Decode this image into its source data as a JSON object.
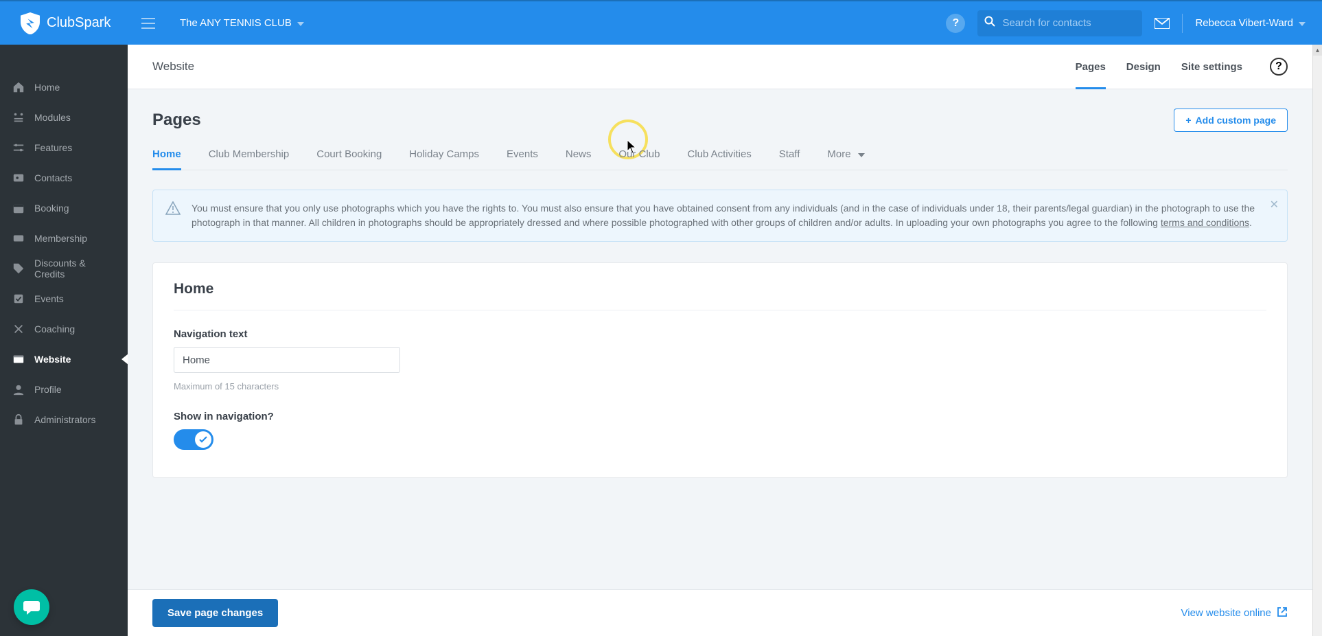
{
  "brand": {
    "name": "ClubSpark"
  },
  "club": {
    "name": "The ANY TENNIS CLUB"
  },
  "search": {
    "placeholder": "Search for contacts"
  },
  "help": {
    "symbol": "?"
  },
  "user": {
    "name": "Rebecca Vibert-Ward"
  },
  "sidebar": {
    "items": [
      {
        "label": "Home"
      },
      {
        "label": "Modules"
      },
      {
        "label": "Features"
      },
      {
        "label": "Contacts"
      },
      {
        "label": "Booking"
      },
      {
        "label": "Membership"
      },
      {
        "label": "Discounts & Credits"
      },
      {
        "label": "Events"
      },
      {
        "label": "Coaching"
      },
      {
        "label": "Website"
      },
      {
        "label": "Profile"
      },
      {
        "label": "Administrators"
      }
    ],
    "active_index": 9
  },
  "subheader": {
    "title": "Website",
    "tabs": [
      {
        "label": "Pages",
        "active": true
      },
      {
        "label": "Design",
        "active": false
      },
      {
        "label": "Site settings",
        "active": false
      }
    ],
    "help_q": "?"
  },
  "page": {
    "title": "Pages",
    "add_button": "Add custom page",
    "tabs": [
      {
        "label": "Home",
        "active": true
      },
      {
        "label": "Club Membership"
      },
      {
        "label": "Court Booking"
      },
      {
        "label": "Holiday Camps"
      },
      {
        "label": "Events"
      },
      {
        "label": "News"
      },
      {
        "label": "Our Club"
      },
      {
        "label": "Club Activities"
      },
      {
        "label": "Staff"
      },
      {
        "label": "More"
      }
    ]
  },
  "notice": {
    "text_a": "You must ensure that you only use photographs which you have the rights to. You must also ensure that you have obtained consent from any individuals (and in the case of individuals under 18, their parents/legal guardian) in the photograph to use the photograph in that manner. All children in photographs should be appropriately dressed and where possible photographed with other groups of children and/or adults. In uploading your own photographs you agree to the following ",
    "link": "terms and conditions",
    "text_b": "."
  },
  "form": {
    "card_title": "Home",
    "nav_text_label": "Navigation text",
    "nav_text_value": "Home",
    "nav_text_help": "Maximum of 15 characters",
    "show_nav_label": "Show in navigation?"
  },
  "bottom": {
    "save": "Save page changes",
    "view": "View website online"
  }
}
